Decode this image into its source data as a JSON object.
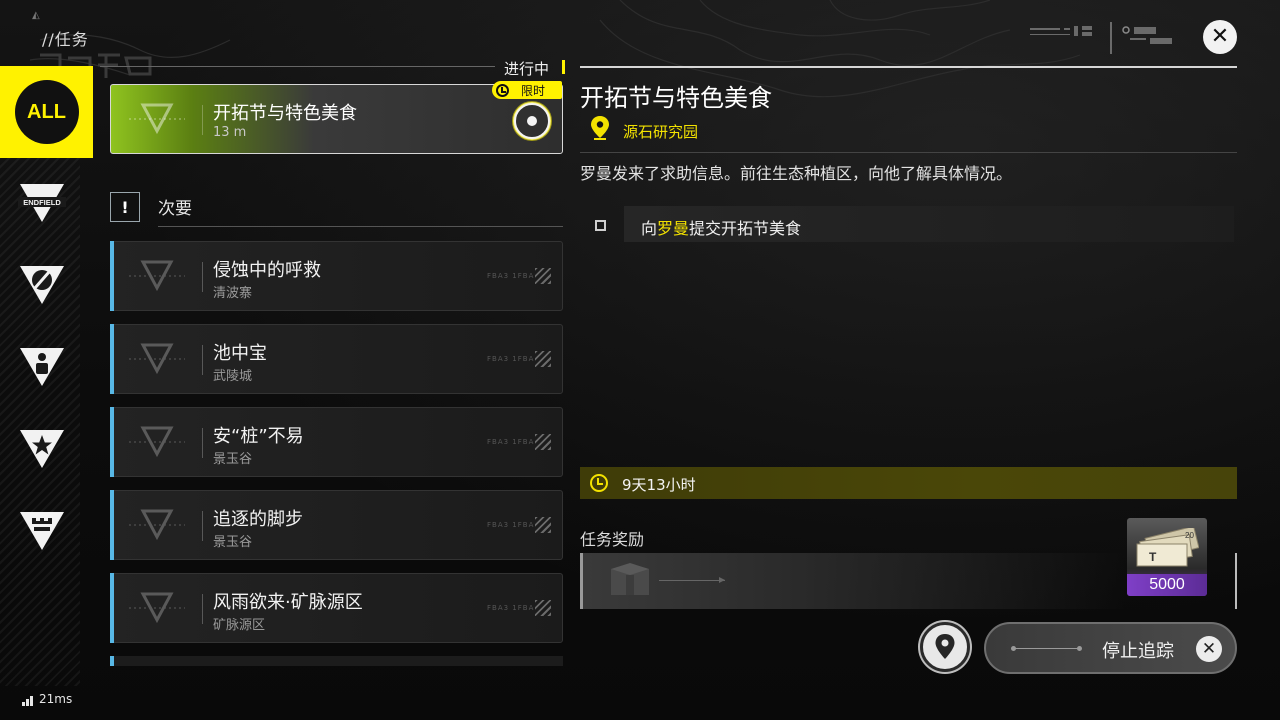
{
  "header": {
    "page_title": "//任务",
    "corner_logo": "◭",
    "close_icon": "close-icon",
    "close_glyph": "✕"
  },
  "categories": [
    {
      "label": "ALL",
      "selected": true,
      "icon": "all-icon"
    },
    {
      "label": "ENDFIELD",
      "icon": "endfield-icon"
    },
    {
      "icon": "pencil-shield-icon"
    },
    {
      "icon": "person-shield-icon"
    },
    {
      "icon": "star-shield-icon"
    },
    {
      "icon": "castle-shield-icon"
    }
  ],
  "quest_list": {
    "status_label": "进行中",
    "active": {
      "title": "开拓节与特色美食",
      "distance": "13 m",
      "tag": "限时",
      "tracked": true
    },
    "section_icon": "!",
    "section_label": "次要",
    "items": [
      {
        "title": "侵蚀中的呼救",
        "location": "清波寨",
        "code": "FBA3 1FBA"
      },
      {
        "title": "池中宝",
        "location": "武陵城",
        "code": "FBA3 1FBA"
      },
      {
        "title": "安“桩”不易",
        "location": "景玉谷",
        "code": "FBA3 1FBA"
      },
      {
        "title": "追逐的脚步",
        "location": "景玉谷",
        "code": "FBA3 1FBA"
      },
      {
        "title": "风雨欲来·矿脉源区",
        "location": "矿脉源区",
        "code": "FBA3 1FBA"
      }
    ]
  },
  "detail": {
    "title": "开拓节与特色美食",
    "location": "源石研究园",
    "description": "罗曼发来了求助信息。前往生态种植区，向他了解具体情况。",
    "objective": {
      "prefix": "向",
      "highlight": "罗曼",
      "suffix": "提交开拓节美食",
      "done": false
    },
    "timer": "9天13小时",
    "rewards_label": "任务奖励",
    "reward": {
      "icon": "bills-icon",
      "quantity": "5000",
      "badge": "20"
    }
  },
  "actions": {
    "map_icon": "map-pin-icon",
    "stop_tracking": "停止追踪",
    "stop_glyph": "✕"
  },
  "status": {
    "ping": "21ms"
  },
  "colors": {
    "accent_yellow": "#fff200",
    "location_yellow": "#f3e200",
    "secondary_blue": "#58b8e6",
    "reward_purple": "#7f3fc7"
  }
}
